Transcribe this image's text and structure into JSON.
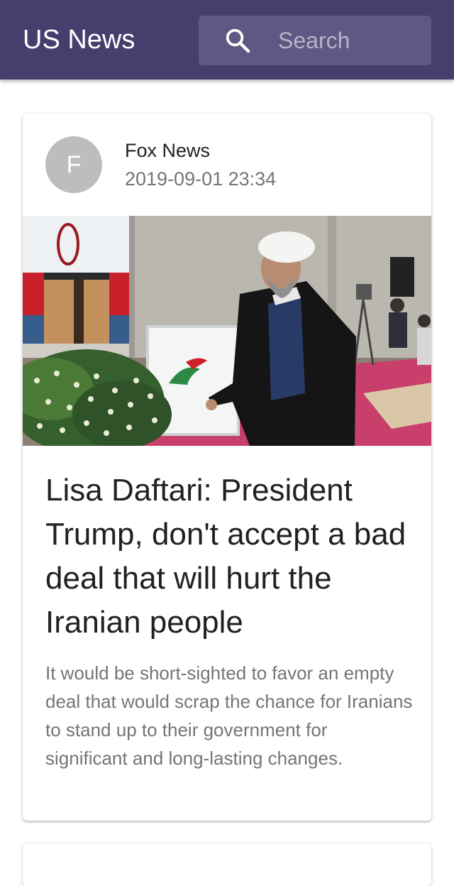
{
  "app_bar": {
    "title": "US News",
    "search": {
      "placeholder": "Search",
      "icon": "search-icon"
    },
    "background": "#463f6d"
  },
  "articles": [
    {
      "avatar_letter": "F",
      "source": "Fox News",
      "date": "2019-09-01 23:34",
      "title": "Lisa Daftari: President Trump, don't accept a bad deal that will hurt the Iranian people",
      "summary": "It would be short-sighted to favor an empty deal that would scrap the chance for Iranians to stand up to their government for significant and long-lasting changes."
    }
  ]
}
